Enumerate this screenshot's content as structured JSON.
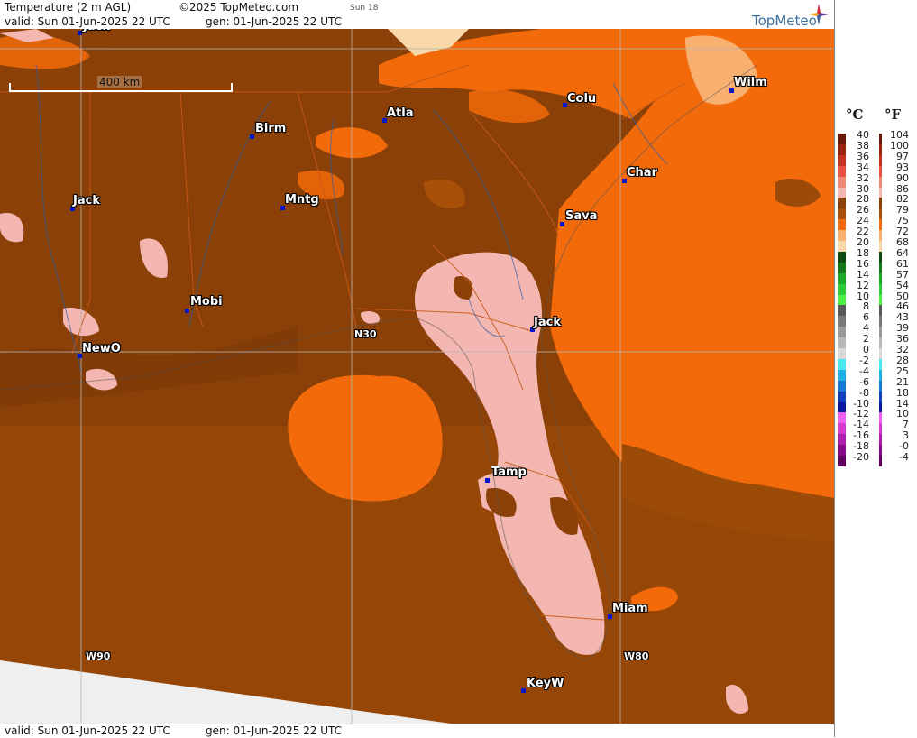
{
  "header": {
    "title": "Temperature (2 m AGL)",
    "copyright": "©2025 TopMeteo.com",
    "day_label": "Sun 18",
    "valid": "valid:  Sun  01-Jun-2025  22 UTC",
    "generated": "gen: 01-Jun-2025 22 UTC",
    "brand": "TopMeteo"
  },
  "footer": {
    "valid": "valid:  Sun  01-Jun-2025  22 UTC",
    "generated": "gen: 01-Jun-2025 22 UTC"
  },
  "map": {
    "scale_label": "400 km",
    "grid_labels": {
      "lat30": "N30",
      "lon90": "W90",
      "lon80": "W80"
    },
    "cities": [
      {
        "name": "Jack"
      },
      {
        "name": "Birm"
      },
      {
        "name": "Atla"
      },
      {
        "name": "Colu"
      },
      {
        "name": "Wilm"
      },
      {
        "name": "Char"
      },
      {
        "name": "Mntg"
      },
      {
        "name": "Sava"
      },
      {
        "name": "Mobi"
      },
      {
        "name": "Jack"
      },
      {
        "name": "NewO"
      },
      {
        "name": "Tamp"
      },
      {
        "name": "Miam"
      },
      {
        "name": "KeyW"
      }
    ]
  },
  "legend": {
    "unit_c": "°C",
    "unit_f": "°F",
    "rows": [
      {
        "c": "40",
        "f": "104",
        "color": "#6a1a08"
      },
      {
        "c": "38",
        "f": "100",
        "color": "#9a2410"
      },
      {
        "c": "36",
        "f": "97",
        "color": "#c83220"
      },
      {
        "c": "34",
        "f": "93",
        "color": "#e85040"
      },
      {
        "c": "32",
        "f": "90",
        "color": "#f08878"
      },
      {
        "c": "30",
        "f": "86",
        "color": "#f4b6b0"
      },
      {
        "c": "28",
        "f": "82",
        "color": "#8a4006"
      },
      {
        "c": "26",
        "f": "79",
        "color": "#a85008"
      },
      {
        "c": "24",
        "f": "75",
        "color": "#f26a0a"
      },
      {
        "c": "22",
        "f": "72",
        "color": "#f8b070"
      },
      {
        "c": "20",
        "f": "68",
        "color": "#f8d8a8"
      },
      {
        "c": "18",
        "f": "64",
        "color": "#0c4a12"
      },
      {
        "c": "16",
        "f": "61",
        "color": "#137a1c"
      },
      {
        "c": "14",
        "f": "57",
        "color": "#1ea82a"
      },
      {
        "c": "12",
        "f": "54",
        "color": "#2ccc38"
      },
      {
        "c": "10",
        "f": "50",
        "color": "#48f048"
      },
      {
        "c": "8",
        "f": "46",
        "color": "#585858"
      },
      {
        "c": "6",
        "f": "43",
        "color": "#787878"
      },
      {
        "c": "4",
        "f": "39",
        "color": "#989898"
      },
      {
        "c": "2",
        "f": "36",
        "color": "#b8b8b8"
      },
      {
        "c": "0",
        "f": "32",
        "color": "#d8d8d8"
      },
      {
        "c": "-2",
        "f": "28",
        "color": "#48e8f0"
      },
      {
        "c": "-4",
        "f": "25",
        "color": "#20b0e8"
      },
      {
        "c": "-6",
        "f": "21",
        "color": "#1878d8"
      },
      {
        "c": "-8",
        "f": "18",
        "color": "#1040c0"
      },
      {
        "c": "-10",
        "f": "14",
        "color": "#0818a0"
      },
      {
        "c": "-12",
        "f": "10",
        "color": "#f060f0"
      },
      {
        "c": "-14",
        "f": "7",
        "color": "#d838d0"
      },
      {
        "c": "-16",
        "f": "3",
        "color": "#b020b0"
      },
      {
        "c": "-18",
        "f": "-0",
        "color": "#880888"
      },
      {
        "c": "-20",
        "f": "-4",
        "color": "#600060"
      }
    ]
  }
}
